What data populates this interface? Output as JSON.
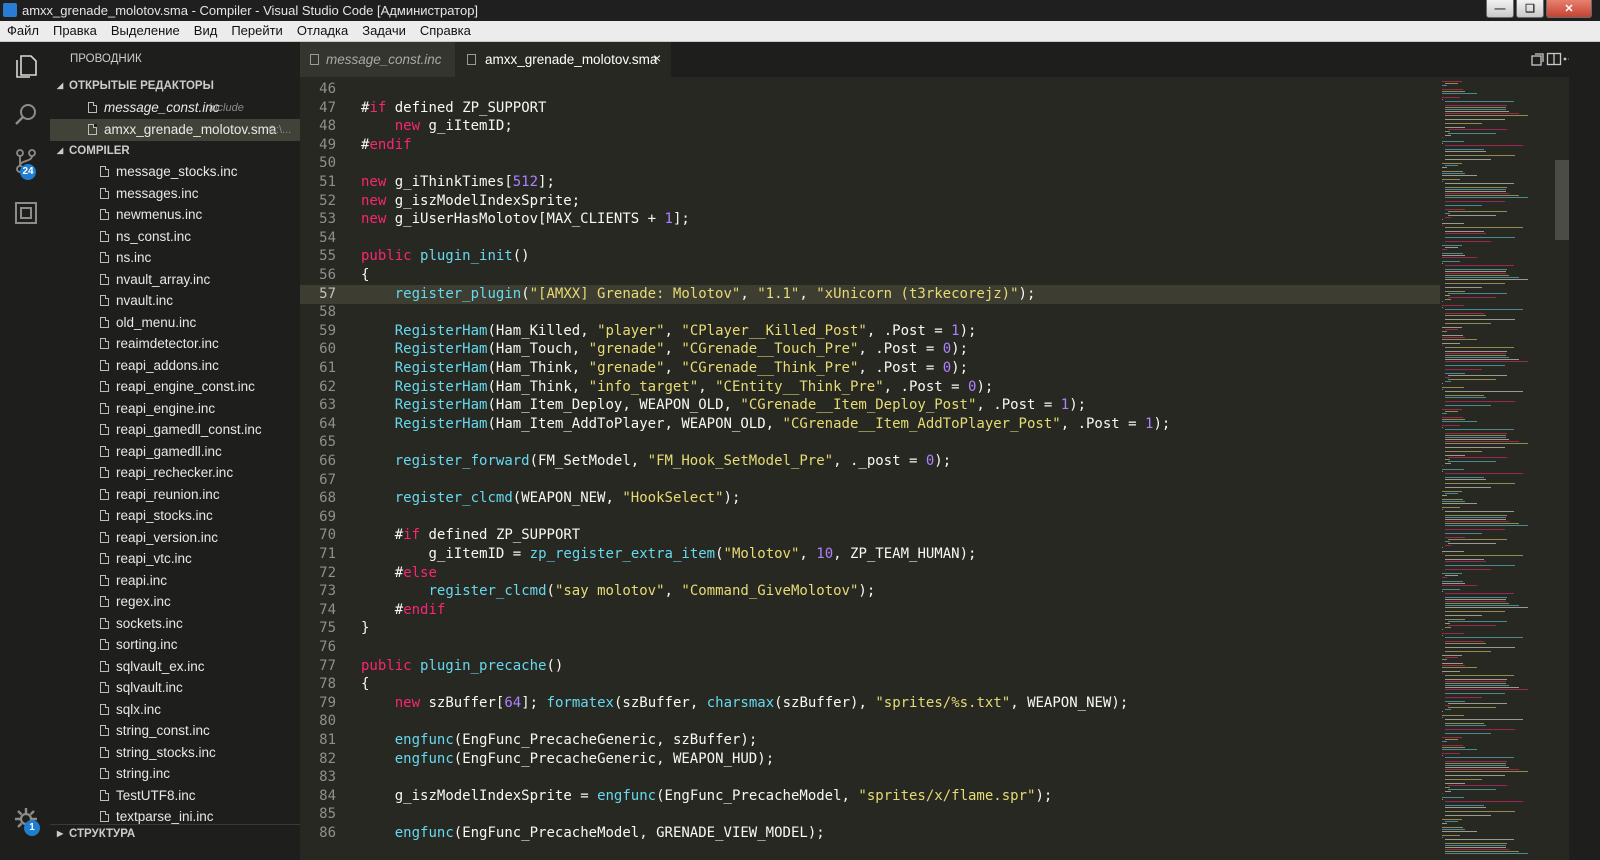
{
  "window": {
    "title": "amxx_grenade_molotov.sma - Compiler - Visual Studio Code [Администратор]",
    "controls": [
      "minimize-icon",
      "maximize-icon",
      "close-icon"
    ]
  },
  "menu": [
    "Файл",
    "Правка",
    "Выделение",
    "Вид",
    "Перейти",
    "Отладка",
    "Задачи",
    "Справка"
  ],
  "activity_bar": {
    "items": [
      "explorer-icon",
      "search-icon",
      "source-control-icon",
      "extensions-icon"
    ],
    "scm_badge": "24",
    "settings_badge": "1"
  },
  "sidebar": {
    "header": "ПРОВОДНИК",
    "open_editors": {
      "title": "ОТКРЫТЫЕ РЕДАКТОРЫ",
      "items": [
        {
          "name": "message_const.inc",
          "desc": "include"
        },
        {
          "name": "amxx_grenade_molotov.sma",
          "desc": "C:\\..."
        }
      ]
    },
    "folder": {
      "title": "COMPILER",
      "files": [
        "message_stocks.inc",
        "messages.inc",
        "newmenus.inc",
        "ns_const.inc",
        "ns.inc",
        "nvault_array.inc",
        "nvault.inc",
        "old_menu.inc",
        "reaimdetector.inc",
        "reapi_addons.inc",
        "reapi_engine_const.inc",
        "reapi_engine.inc",
        "reapi_gamedll_const.inc",
        "reapi_gamedll.inc",
        "reapi_rechecker.inc",
        "reapi_reunion.inc",
        "reapi_stocks.inc",
        "reapi_version.inc",
        "reapi_vtc.inc",
        "reapi.inc",
        "regex.inc",
        "sockets.inc",
        "sorting.inc",
        "sqlvault_ex.inc",
        "sqlvault.inc",
        "sqlx.inc",
        "string_const.inc",
        "string_stocks.inc",
        "string.inc",
        "TestUTF8.inc",
        "textparse_ini.inc"
      ]
    },
    "outline_title": "СТРУКТУРА"
  },
  "tabs": [
    {
      "label": "message_const.inc",
      "active": false
    },
    {
      "label": "amxx_grenade_molotov.sma",
      "active": true,
      "close": "×"
    }
  ],
  "editor": {
    "current_line": "57",
    "lines": [
      {
        "n": "46",
        "t": ""
      },
      {
        "n": "47",
        "t": "#if defined ZP_SUPPORT"
      },
      {
        "n": "48",
        "t": "    new g_iItemID;"
      },
      {
        "n": "49",
        "t": "#endif"
      },
      {
        "n": "50",
        "t": ""
      },
      {
        "n": "51",
        "t": "new g_iThinkTimes[512];"
      },
      {
        "n": "52",
        "t": "new g_iszModelIndexSprite;"
      },
      {
        "n": "53",
        "t": "new g_iUserHasMolotov[MAX_CLIENTS + 1];"
      },
      {
        "n": "54",
        "t": ""
      },
      {
        "n": "55",
        "t": "public plugin_init()"
      },
      {
        "n": "56",
        "t": "{"
      },
      {
        "n": "57",
        "t": "    register_plugin(\"[AMXX] Grenade: Molotov\", \"1.1\", \"xUnicorn (t3rkecorejz)\");"
      },
      {
        "n": "58",
        "t": ""
      },
      {
        "n": "59",
        "t": "    RegisterHam(Ham_Killed, \"player\", \"CPlayer__Killed_Post\", .Post = 1);"
      },
      {
        "n": "60",
        "t": "    RegisterHam(Ham_Touch, \"grenade\", \"CGrenade__Touch_Pre\", .Post = 0);"
      },
      {
        "n": "61",
        "t": "    RegisterHam(Ham_Think, \"grenade\", \"CGrenade__Think_Pre\", .Post = 0);"
      },
      {
        "n": "62",
        "t": "    RegisterHam(Ham_Think, \"info_target\", \"CEntity__Think_Pre\", .Post = 0);"
      },
      {
        "n": "63",
        "t": "    RegisterHam(Ham_Item_Deploy, WEAPON_OLD, \"CGrenade__Item_Deploy_Post\", .Post = 1);"
      },
      {
        "n": "64",
        "t": "    RegisterHam(Ham_Item_AddToPlayer, WEAPON_OLD, \"CGrenade__Item_AddToPlayer_Post\", .Post = 1);"
      },
      {
        "n": "65",
        "t": ""
      },
      {
        "n": "66",
        "t": "    register_forward(FM_SetModel, \"FM_Hook_SetModel_Pre\", ._post = 0);"
      },
      {
        "n": "67",
        "t": ""
      },
      {
        "n": "68",
        "t": "    register_clcmd(WEAPON_NEW, \"HookSelect\");"
      },
      {
        "n": "69",
        "t": ""
      },
      {
        "n": "70",
        "t": "    #if defined ZP_SUPPORT"
      },
      {
        "n": "71",
        "t": "        g_iItemID = zp_register_extra_item(\"Molotov\", 10, ZP_TEAM_HUMAN);"
      },
      {
        "n": "72",
        "t": "    #else"
      },
      {
        "n": "73",
        "t": "        register_clcmd(\"say molotov\", \"Command_GiveMolotov\");"
      },
      {
        "n": "74",
        "t": "    #endif"
      },
      {
        "n": "75",
        "t": "}"
      },
      {
        "n": "76",
        "t": ""
      },
      {
        "n": "77",
        "t": "public plugin_precache()"
      },
      {
        "n": "78",
        "t": "{"
      },
      {
        "n": "79",
        "t": "    new szBuffer[64]; formatex(szBuffer, charsmax(szBuffer), \"sprites/%s.txt\", WEAPON_NEW);"
      },
      {
        "n": "80",
        "t": ""
      },
      {
        "n": "81",
        "t": "    engfunc(EngFunc_PrecacheGeneric, szBuffer);"
      },
      {
        "n": "82",
        "t": "    engfunc(EngFunc_PrecacheGeneric, WEAPON_HUD);"
      },
      {
        "n": "83",
        "t": ""
      },
      {
        "n": "84",
        "t": "    g_iszModelIndexSprite = engfunc(EngFunc_PrecacheModel, \"sprites/x/flame.spr\");"
      },
      {
        "n": "85",
        "t": ""
      },
      {
        "n": "86",
        "t": "    engfunc(EngFunc_PrecacheModel, GRENADE_VIEW_MODEL);"
      }
    ]
  },
  "theme": {
    "keyword": "#f92672",
    "string": "#e6db74",
    "number": "#ae81ff",
    "function": "#66d9ef",
    "plain": "#f8f8f2"
  }
}
